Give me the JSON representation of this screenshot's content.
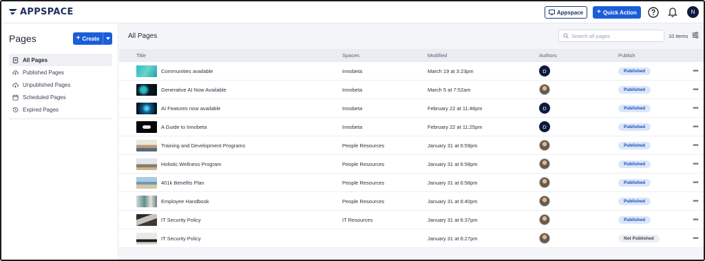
{
  "app": {
    "logo_text": "APPSPACE"
  },
  "topbar": {
    "appspace_button": "Appspace",
    "quick_action_button": "Quick Action",
    "user_initial": "N"
  },
  "sidebar": {
    "title": "Pages",
    "create_button": "Create",
    "items": [
      {
        "label": "All Pages",
        "icon": "document-icon",
        "active": true
      },
      {
        "label": "Published Pages",
        "icon": "cloud-upload-icon",
        "active": false
      },
      {
        "label": "Unpublished Pages",
        "icon": "cloud-download-icon",
        "active": false
      },
      {
        "label": "Scheduled Pages",
        "icon": "calendar-icon",
        "active": false
      },
      {
        "label": "Expired Pages",
        "icon": "history-icon",
        "active": false
      }
    ]
  },
  "main": {
    "title": "All Pages",
    "search_placeholder": "Search all pages",
    "item_count": "10 items",
    "columns": [
      "Title",
      "Spaces",
      "Modified",
      "Authors",
      "Publish"
    ],
    "rows": [
      {
        "title": "Communities available",
        "space": "Innobeta",
        "modified": "March 19 at 3:23pm",
        "author": "D",
        "status": "Published"
      },
      {
        "title": "Generative AI Now Available",
        "space": "Innobeta",
        "modified": "March 5 at 7:52am",
        "author": "photo",
        "status": "Published"
      },
      {
        "title": "AI Features now available",
        "space": "Innobeta",
        "modified": "February 22 at 11:48pm",
        "author": "D",
        "status": "Published"
      },
      {
        "title": "A Guide to Innobeta",
        "space": "Innobeta",
        "modified": "February 22 at 11:25pm",
        "author": "D",
        "status": "Published"
      },
      {
        "title": "Training and Development Programs",
        "space": "People Resources",
        "modified": "January 31 at 6:59pm",
        "author": "photo",
        "status": "Published"
      },
      {
        "title": "Holistic Wellness Program",
        "space": "People Resources",
        "modified": "January 31 at 6:58pm",
        "author": "photo",
        "status": "Published"
      },
      {
        "title": "401k Benefits Plan",
        "space": "People Resources",
        "modified": "January 31 at 6:58pm",
        "author": "photo",
        "status": "Published"
      },
      {
        "title": "Employee Handbook",
        "space": "People Resources",
        "modified": "January 31 at 6:40pm",
        "author": "photo",
        "status": "Published"
      },
      {
        "title": "IT Security Policy",
        "space": "IT Resources",
        "modified": "January 31 at 6:37pm",
        "author": "photo",
        "status": "Published"
      },
      {
        "title": "IT Security Policy",
        "space": "",
        "modified": "January 31 at 6:27pm",
        "author": "photo",
        "status": "Not Published"
      }
    ]
  },
  "colors": {
    "primary": "#1a5ed8",
    "navy": "#0e1a3d",
    "badge_published_bg": "#dbe6fb",
    "badge_published_text": "#1a4fb8"
  }
}
